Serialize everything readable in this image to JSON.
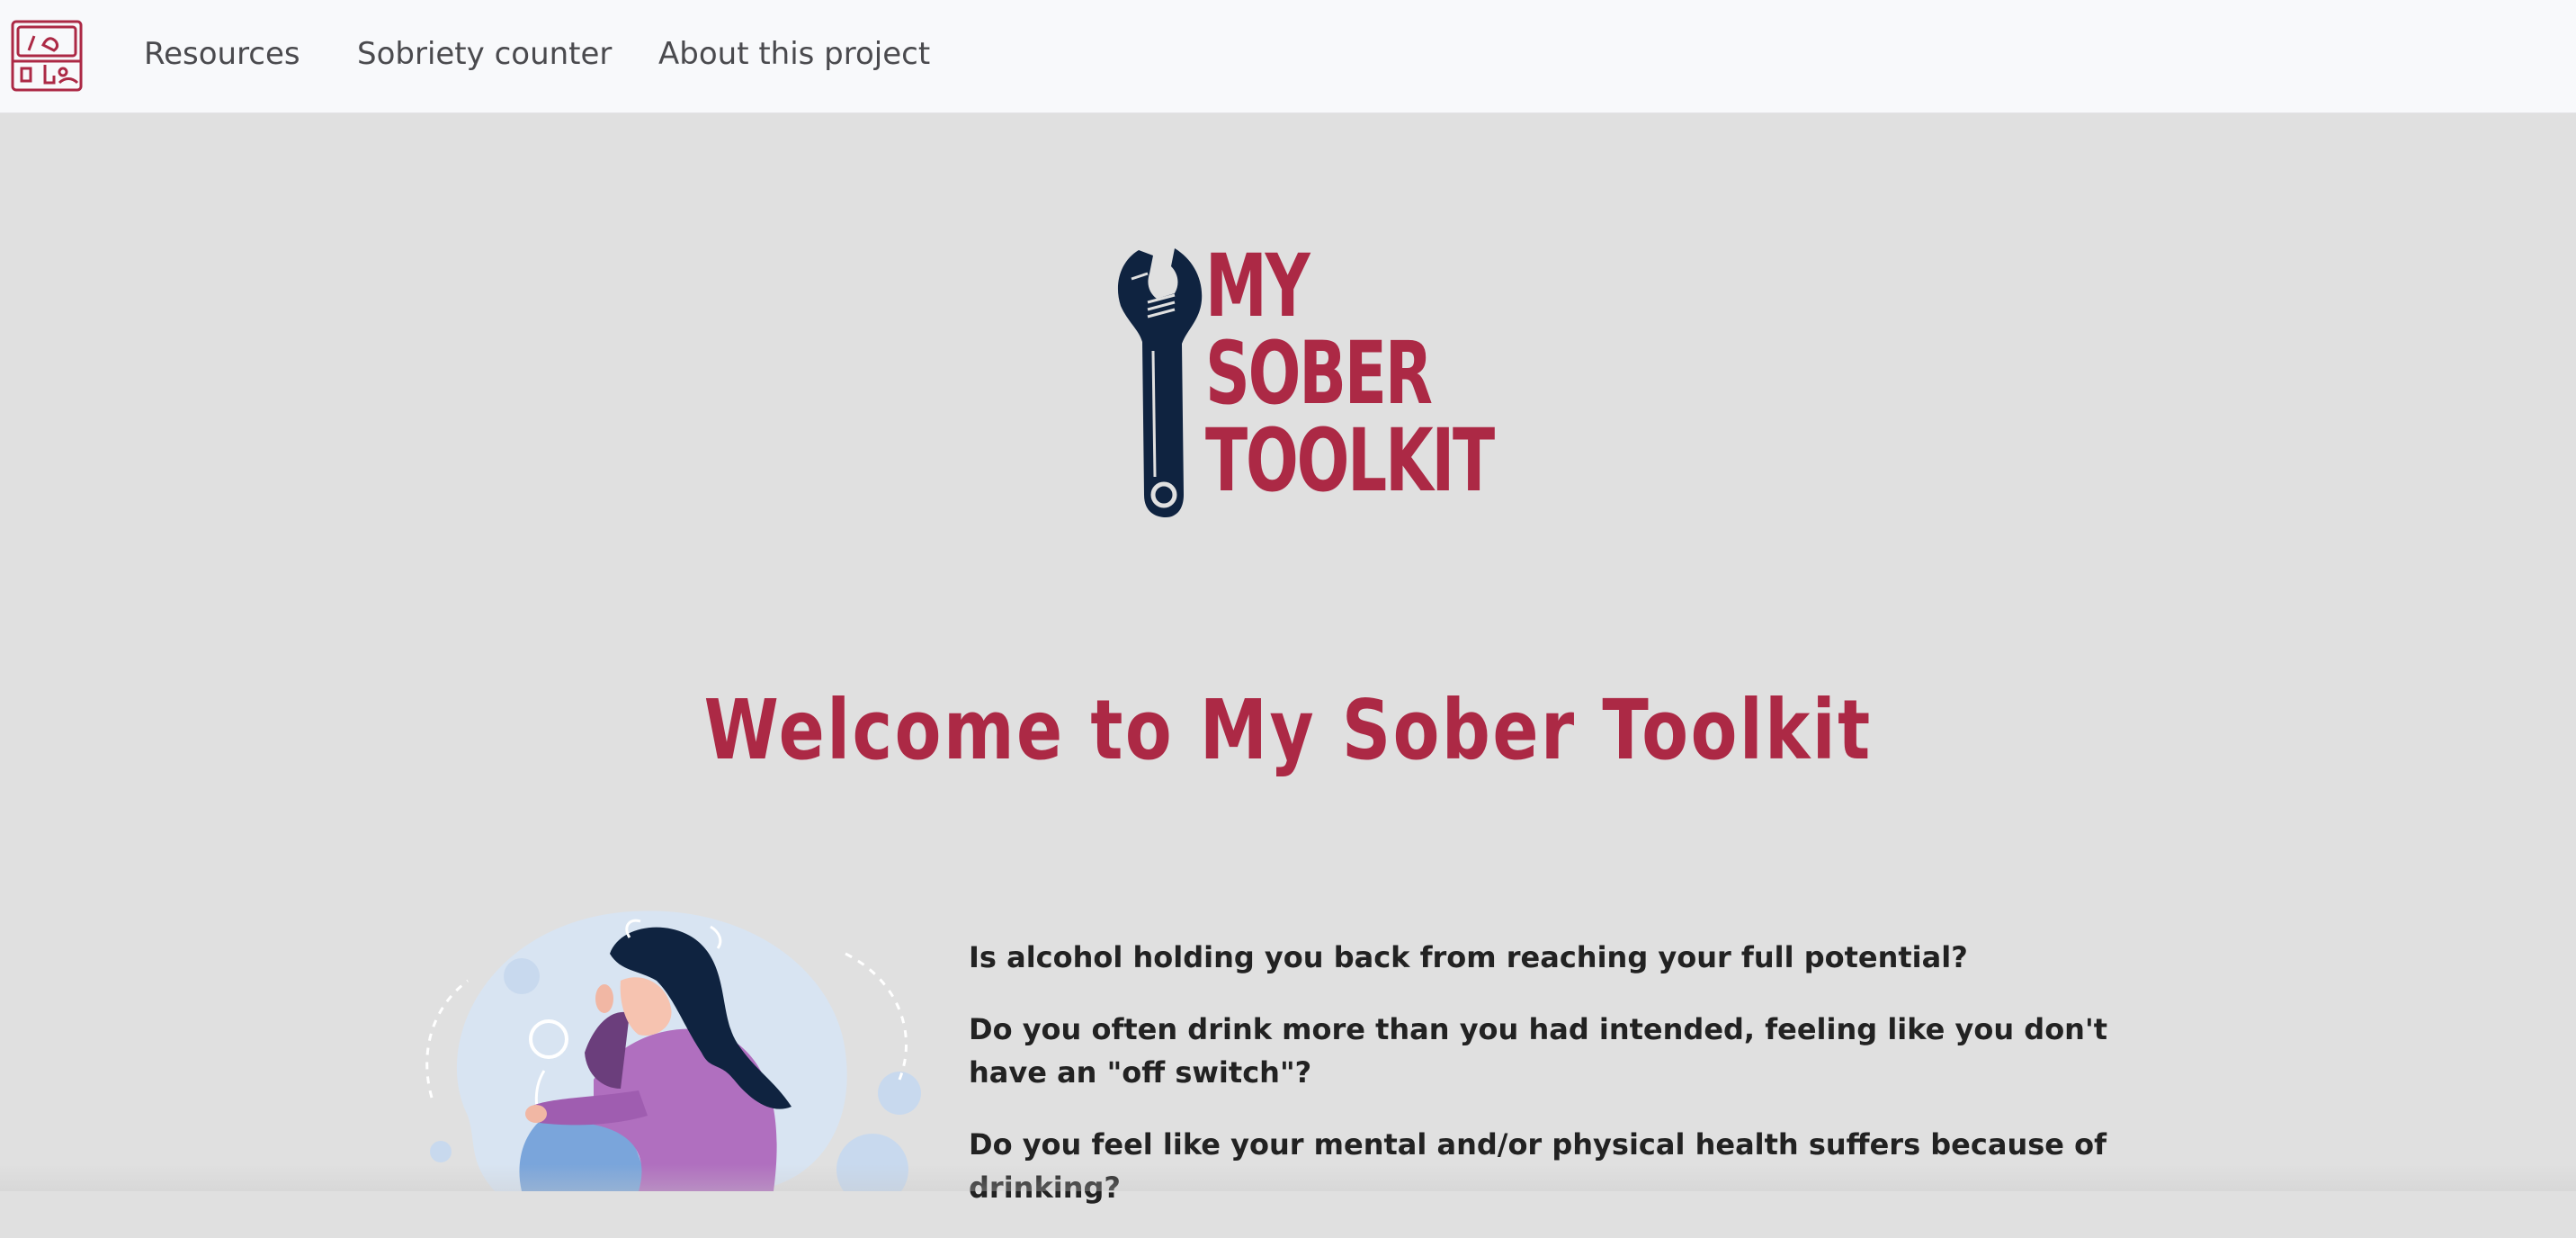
{
  "navbar": {
    "logo_icon": "toolkit-logo-icon",
    "links": [
      {
        "label": "Resources"
      },
      {
        "label": "Sobriety counter"
      },
      {
        "label": "About this project"
      }
    ]
  },
  "hero": {
    "logo_words": [
      "MY",
      "SOBER",
      "TOOLKIT"
    ],
    "logo_icon": "wrench-icon",
    "title": "Welcome to My Sober Toolkit"
  },
  "intro": {
    "illustration": "sad-woman-illustration",
    "questions": [
      "Is alcohol holding you back from reaching your full potential?",
      "Do you often drink more than you had intended, feeling like you don't have an \"off switch\"?",
      "Do you feel like your mental and/or physical health suffers because of drinking?"
    ]
  },
  "colors": {
    "brand": "#ac2945",
    "navy": "#0f2340",
    "background": "#e0e0e0",
    "navbar": "#f8f9fb"
  }
}
